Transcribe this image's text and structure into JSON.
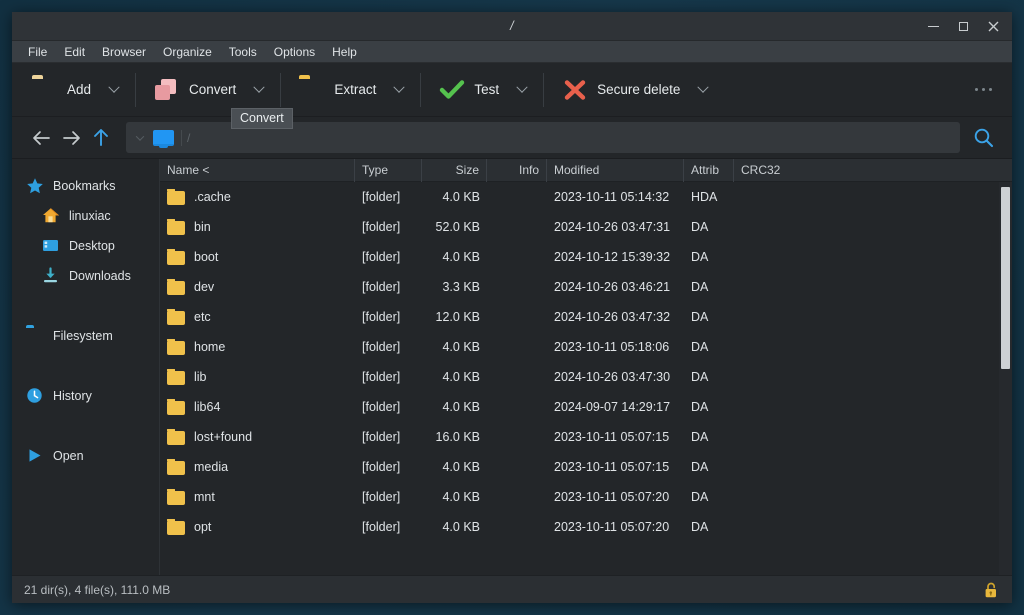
{
  "window": {
    "title": "/",
    "controls": {
      "minimize": "–",
      "maximize": "□",
      "close": "✕"
    }
  },
  "menubar": {
    "items": [
      {
        "label": "File"
      },
      {
        "label": "Edit"
      },
      {
        "label": "Browser"
      },
      {
        "label": "Organize"
      },
      {
        "label": "Tools"
      },
      {
        "label": "Options"
      },
      {
        "label": "Help"
      }
    ]
  },
  "toolbar": {
    "buttons": [
      {
        "label": "Add",
        "icon": "folder-add-icon",
        "has_caret": true
      },
      {
        "label": "Convert",
        "icon": "convert-icon",
        "has_caret": true
      },
      {
        "label": "Extract",
        "icon": "folder-extract-icon",
        "has_caret": true
      },
      {
        "label": "Test",
        "icon": "checkmark-icon",
        "has_caret": true
      },
      {
        "label": "Secure delete",
        "icon": "red-x-icon",
        "has_caret": true
      }
    ],
    "overflow_label": "…",
    "tooltip": "Convert"
  },
  "navbar": {
    "back": "←",
    "forward": "→",
    "up": "↑",
    "address": {
      "root_chunk_icon": "computer-icon",
      "separator": "/"
    },
    "search_icon": "search-icon"
  },
  "sidebar": {
    "items": [
      {
        "label": "Bookmarks",
        "icon": "star-icon",
        "level": 0
      },
      {
        "label": "linuxiac",
        "icon": "home-icon",
        "level": 1
      },
      {
        "label": "Desktop",
        "icon": "desktop-icon",
        "level": 1
      },
      {
        "label": "Downloads",
        "icon": "download-icon",
        "level": 1
      },
      {
        "label": "Filesystem",
        "icon": "folder-icon",
        "level": 0
      },
      {
        "label": "History",
        "icon": "clock-icon",
        "level": 0
      },
      {
        "label": "Open",
        "icon": "play-icon",
        "level": 0
      }
    ]
  },
  "filelist": {
    "columns": [
      {
        "key": "name",
        "label": "Name <",
        "align": "left"
      },
      {
        "key": "type",
        "label": "Type",
        "align": "left"
      },
      {
        "key": "size",
        "label": "Size",
        "align": "right"
      },
      {
        "key": "info",
        "label": "Info",
        "align": "right"
      },
      {
        "key": "modified",
        "label": "Modified",
        "align": "left"
      },
      {
        "key": "attributes",
        "label": "Attrib",
        "align": "left"
      },
      {
        "key": "crc32",
        "label": "CRC32",
        "align": "left"
      }
    ],
    "rows": [
      {
        "name": ".cache",
        "type": "[folder]",
        "size": "4.0 KB",
        "info": "",
        "modified": "2023-10-11 05:14:32",
        "attributes": "HDA",
        "crc32": ""
      },
      {
        "name": "bin",
        "type": "[folder]",
        "size": "52.0 KB",
        "info": "",
        "modified": "2024-10-26 03:47:31",
        "attributes": "DA",
        "crc32": ""
      },
      {
        "name": "boot",
        "type": "[folder]",
        "size": "4.0 KB",
        "info": "",
        "modified": "2024-10-12 15:39:32",
        "attributes": "DA",
        "crc32": ""
      },
      {
        "name": "dev",
        "type": "[folder]",
        "size": "3.3 KB",
        "info": "",
        "modified": "2024-10-26 03:46:21",
        "attributes": "DA",
        "crc32": ""
      },
      {
        "name": "etc",
        "type": "[folder]",
        "size": "12.0 KB",
        "info": "",
        "modified": "2024-10-26 03:47:32",
        "attributes": "DA",
        "crc32": ""
      },
      {
        "name": "home",
        "type": "[folder]",
        "size": "4.0 KB",
        "info": "",
        "modified": "2023-10-11 05:18:06",
        "attributes": "DA",
        "crc32": ""
      },
      {
        "name": "lib",
        "type": "[folder]",
        "size": "4.0 KB",
        "info": "",
        "modified": "2024-10-26 03:47:30",
        "attributes": "DA",
        "crc32": ""
      },
      {
        "name": "lib64",
        "type": "[folder]",
        "size": "4.0 KB",
        "info": "",
        "modified": "2024-09-07 14:29:17",
        "attributes": "DA",
        "crc32": ""
      },
      {
        "name": "lost+found",
        "type": "[folder]",
        "size": "16.0 KB",
        "info": "",
        "modified": "2023-10-11 05:07:15",
        "attributes": "DA",
        "crc32": ""
      },
      {
        "name": "media",
        "type": "[folder]",
        "size": "4.0 KB",
        "info": "",
        "modified": "2023-10-11 05:07:15",
        "attributes": "DA",
        "crc32": ""
      },
      {
        "name": "mnt",
        "type": "[folder]",
        "size": "4.0 KB",
        "info": "",
        "modified": "2023-10-11 05:07:20",
        "attributes": "DA",
        "crc32": ""
      },
      {
        "name": "opt",
        "type": "[folder]",
        "size": "4.0 KB",
        "info": "",
        "modified": "2023-10-11 05:07:20",
        "attributes": "DA",
        "crc32": ""
      }
    ]
  },
  "statusbar": {
    "text": "21 dir(s), 4 file(s), 111.0 MB",
    "lock_icon": "unlocked-padlock-icon"
  },
  "colors": {
    "window_bg": "#232629",
    "chrome": "#2b2f33",
    "menubar": "#3a3f44",
    "accent_blue": "#2196f3",
    "folder_yellow": "#f0c14b",
    "check_green": "#4caf50",
    "delete_red": "#e8604c",
    "convert_pink": "#e79aa0",
    "desktop_bg": "#16374a"
  }
}
